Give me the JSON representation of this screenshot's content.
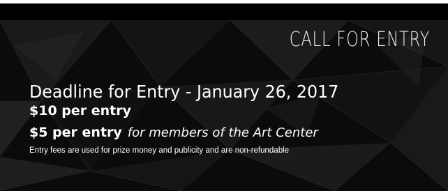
{
  "banner": {
    "headline": "CALL FOR ENTRY",
    "deadline": "Deadline for Entry - January 26, 2017",
    "fee_standard": "$10 per entry",
    "fee_member": "$5 per entry",
    "fee_member_note": "for members of the Art Center",
    "fine_print": "Entry fees are used for prize money and publicity and are non-refundable"
  },
  "colors": {
    "background": "#0b0b0b",
    "text": "#ffffff"
  }
}
